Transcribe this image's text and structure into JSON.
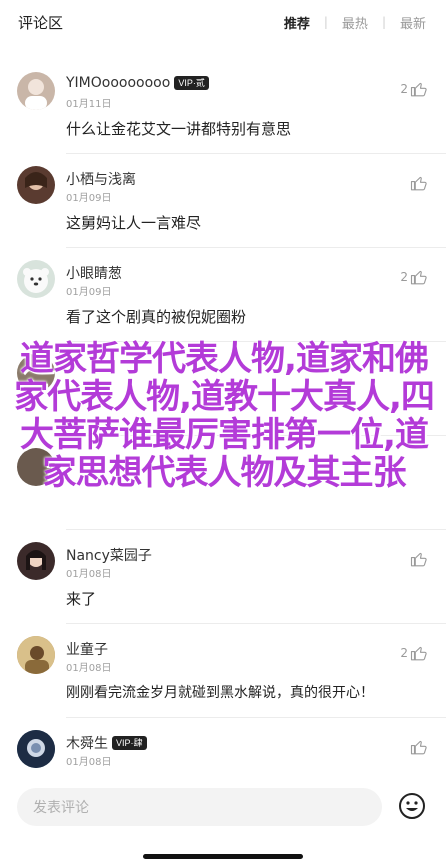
{
  "header": {
    "title": "评论区",
    "tabs": [
      "推荐",
      "最热",
      "最新"
    ],
    "active_tab": "推荐"
  },
  "comments": [
    {
      "name": "YIMOoooooooo",
      "badge": "VIP·贰",
      "date": "01月11日",
      "text": "什么让金花艾文一讲都特别有意思",
      "likes": "2",
      "avatar_color": "#c9b6a8"
    },
    {
      "name": "小栖与浅离",
      "badge": "",
      "date": "01月09日",
      "text": "这舅妈让人一言难尽",
      "likes": "",
      "avatar_color": "#5a3b30"
    },
    {
      "name": "小眼睛葱",
      "badge": "",
      "date": "01月09日",
      "text": "看了这个剧真的被倪妮圈粉",
      "likes": "2",
      "avatar_color": "#d8e3dc"
    },
    {
      "name": "Nancy菜园子",
      "badge": "",
      "date": "01月08日",
      "text": "来了",
      "likes": "",
      "avatar_color": "#3b2a2a"
    },
    {
      "name": "Nancy菜园子",
      "badge": "",
      "date": "01月08日",
      "text": "来了",
      "likes": "",
      "avatar_color": "#3b2a2a"
    },
    {
      "name": "业童子",
      "badge": "",
      "date": "01月08日",
      "text": "刚刚看完流金岁月就碰到黑水解说，真的很开心！",
      "likes": "2",
      "avatar_color": "#b08a55"
    },
    {
      "name": "木舜生",
      "badge": "VIP·肆",
      "date": "01月08日",
      "text": "",
      "likes": "",
      "avatar_color": "#4a6e8c"
    }
  ],
  "overlay_text": "道家哲学代表人物,道家和佛家代表人物,道教十大真人,四大菩萨谁最厉害排第一位,道家思想代表人物及其主张",
  "input": {
    "placeholder": "发表评论"
  },
  "icons": {
    "like": "thumbs-up-icon",
    "emoji": "smiley-icon"
  }
}
